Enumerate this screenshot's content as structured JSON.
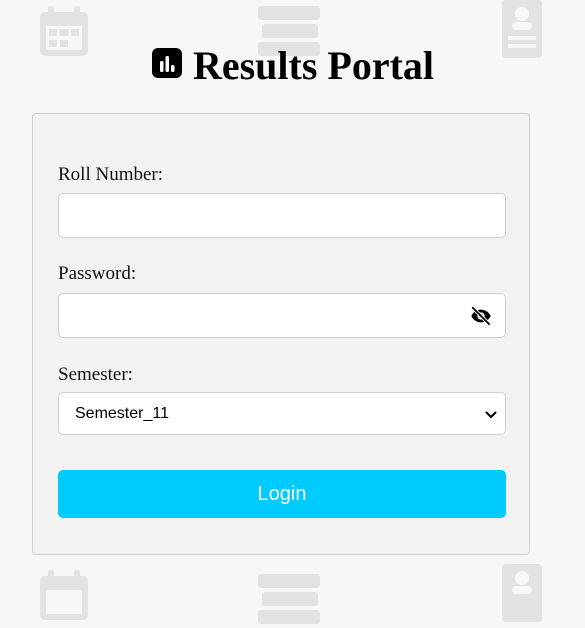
{
  "header": {
    "title": "Results Portal",
    "icon": "bar-chart-icon"
  },
  "form": {
    "roll_label": "Roll Number:",
    "roll_value": "",
    "password_label": "Password:",
    "password_value": "",
    "password_toggle_icon": "eye-slash-icon",
    "semester_label": "Semester:",
    "semester_selected": "Semester_11",
    "login_label": "Login"
  },
  "background_icons": [
    "calendar-icon",
    "books-icon",
    "id-card-icon"
  ],
  "colors": {
    "accent": "#00cbff",
    "page_bg": "#f7f7f7",
    "card_bg": "#f2f2f2"
  }
}
